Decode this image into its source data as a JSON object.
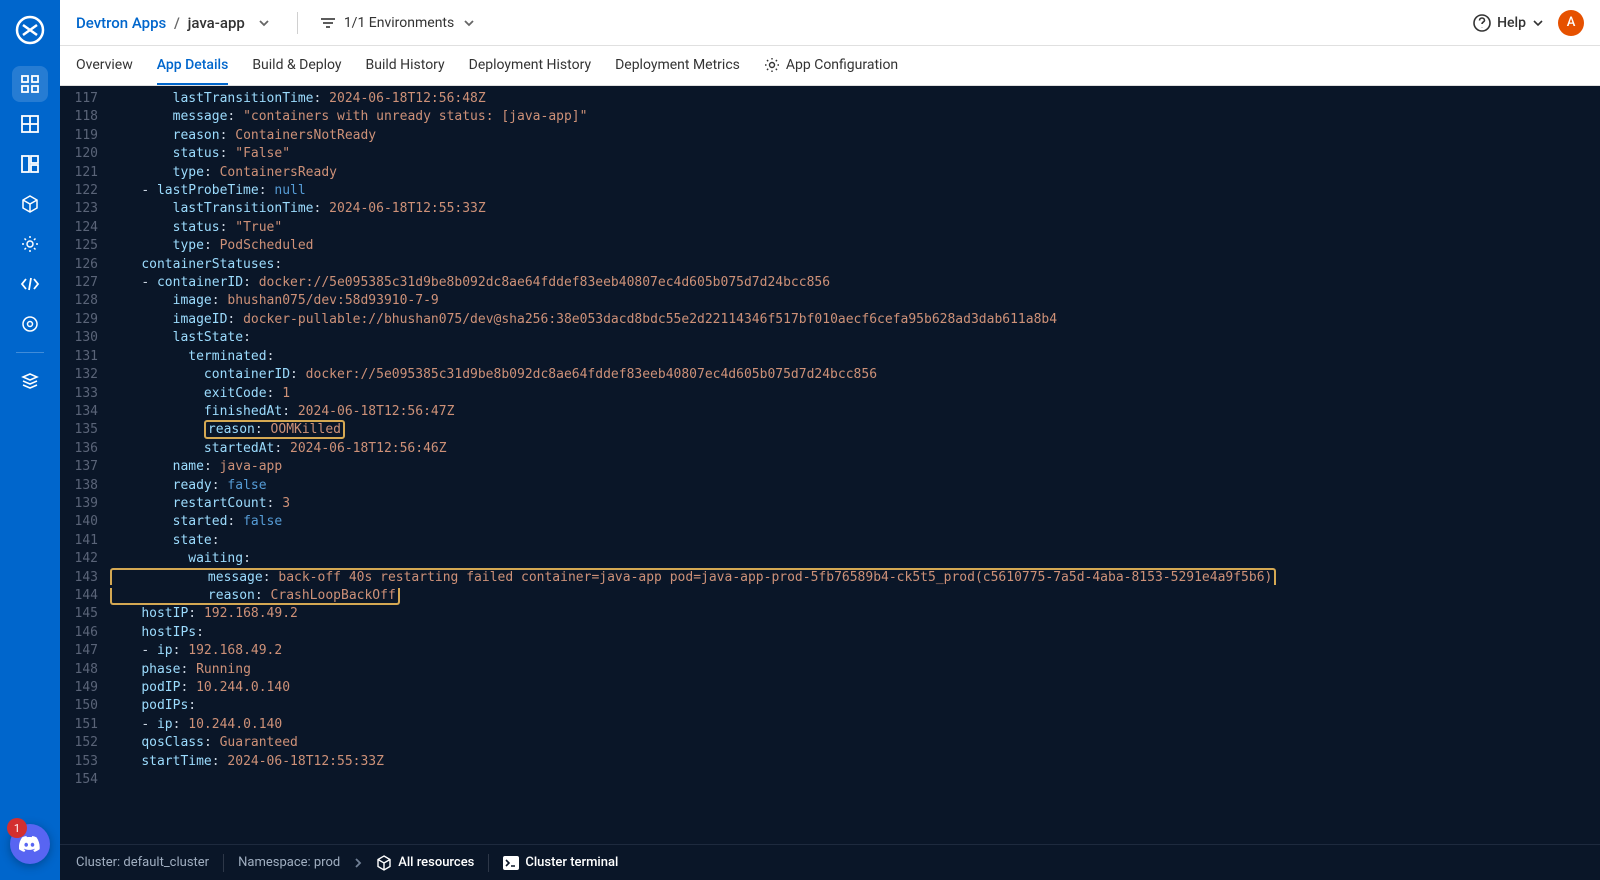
{
  "header": {
    "breadcrumb_root": "Devtron Apps",
    "breadcrumb_app": "java-app",
    "env_filter_label": "1/1 Environments",
    "help_label": "Help",
    "avatar_initial": "A"
  },
  "tabs": {
    "overview": "Overview",
    "app_details": "App Details",
    "build_deploy": "Build & Deploy",
    "build_history": "Build History",
    "deployment_history": "Deployment History",
    "deployment_metrics": "Deployment Metrics",
    "app_configuration": "App Configuration"
  },
  "discord_count": "1",
  "footer": {
    "cluster": "Cluster: default_cluster",
    "namespace": "Namespace: prod",
    "all_resources": "All resources",
    "cluster_terminal": "Cluster terminal"
  },
  "yaml_lines": [
    {
      "num": 117,
      "indent": 4,
      "key": "lastTransitionTime",
      "val": "2024-06-18T12:56:48Z"
    },
    {
      "num": 118,
      "indent": 4,
      "key": "message",
      "val": "\"containers with unready status: [java-app]\""
    },
    {
      "num": 119,
      "indent": 4,
      "key": "reason",
      "val": "ContainersNotReady"
    },
    {
      "num": 120,
      "indent": 4,
      "key": "status",
      "val": "\"False\""
    },
    {
      "num": 121,
      "indent": 4,
      "key": "type",
      "val": "ContainersReady"
    },
    {
      "num": 122,
      "indent": 3,
      "dash": true,
      "key": "lastProbeTime",
      "val": "null",
      "bool": true
    },
    {
      "num": 123,
      "indent": 4,
      "key": "lastTransitionTime",
      "val": "2024-06-18T12:55:33Z"
    },
    {
      "num": 124,
      "indent": 4,
      "key": "status",
      "val": "\"True\""
    },
    {
      "num": 125,
      "indent": 4,
      "key": "type",
      "val": "PodScheduled"
    },
    {
      "num": 126,
      "indent": 2,
      "key": "containerStatuses",
      "val": ""
    },
    {
      "num": 127,
      "indent": 3,
      "dash": true,
      "key": "containerID",
      "val": "docker://5e095385c31d9be8b092dc8ae64fddef83eeb40807ec4d605b075d7d24bcc856"
    },
    {
      "num": 128,
      "indent": 4,
      "key": "image",
      "val": "bhushan075/dev:58d93910-7-9"
    },
    {
      "num": 129,
      "indent": 4,
      "key": "imageID",
      "val": "docker-pullable://bhushan075/dev@sha256:38e053dacd8bdc55e2d22114346f517bf010aecf6cefa95b628ad3dab611a8b4"
    },
    {
      "num": 130,
      "indent": 4,
      "key": "lastState",
      "val": ""
    },
    {
      "num": 131,
      "indent": 5,
      "key": "terminated",
      "val": ""
    },
    {
      "num": 132,
      "indent": 6,
      "key": "containerID",
      "val": "docker://5e095385c31d9be8b092dc8ae64fddef83eeb40807ec4d605b075d7d24bcc856"
    },
    {
      "num": 133,
      "indent": 6,
      "key": "exitCode",
      "val": "1"
    },
    {
      "num": 134,
      "indent": 6,
      "key": "finishedAt",
      "val": "2024-06-18T12:56:47Z"
    },
    {
      "num": 135,
      "indent": 6,
      "key": "reason",
      "val": "OOMKilled",
      "highlight": "inline"
    },
    {
      "num": 136,
      "indent": 6,
      "key": "startedAt",
      "val": "2024-06-18T12:56:46Z"
    },
    {
      "num": 137,
      "indent": 4,
      "key": "name",
      "val": "java-app"
    },
    {
      "num": 138,
      "indent": 4,
      "key": "ready",
      "val": "false",
      "bool": true
    },
    {
      "num": 139,
      "indent": 4,
      "key": "restartCount",
      "val": "3"
    },
    {
      "num": 140,
      "indent": 4,
      "key": "started",
      "val": "false",
      "bool": true
    },
    {
      "num": 141,
      "indent": 4,
      "key": "state",
      "val": ""
    },
    {
      "num": 142,
      "indent": 5,
      "key": "waiting",
      "val": ""
    },
    {
      "num": 143,
      "indent": 6,
      "key": "message",
      "val": "back-off 40s restarting failed container=java-app pod=java-app-prod-5fb76589b4-ck5t5_prod(c5610775-7a5d-4aba-8153-5291e4a9f5b6)",
      "highlight": "block-start"
    },
    {
      "num": 144,
      "indent": 6,
      "key": "reason",
      "val": "CrashLoopBackOff",
      "highlight": "block-end"
    },
    {
      "num": 145,
      "indent": 2,
      "key": "hostIP",
      "val": "192.168.49.2"
    },
    {
      "num": 146,
      "indent": 2,
      "key": "hostIPs",
      "val": ""
    },
    {
      "num": 147,
      "indent": 3,
      "dash": true,
      "key": "ip",
      "val": "192.168.49.2"
    },
    {
      "num": 148,
      "indent": 2,
      "key": "phase",
      "val": "Running"
    },
    {
      "num": 149,
      "indent": 2,
      "key": "podIP",
      "val": "10.244.0.140"
    },
    {
      "num": 150,
      "indent": 2,
      "key": "podIPs",
      "val": ""
    },
    {
      "num": 151,
      "indent": 3,
      "dash": true,
      "key": "ip",
      "val": "10.244.0.140"
    },
    {
      "num": 152,
      "indent": 2,
      "key": "qosClass",
      "val": "Guaranteed"
    },
    {
      "num": 153,
      "indent": 2,
      "key": "startTime",
      "val": "2024-06-18T12:55:33Z"
    },
    {
      "num": 154,
      "indent": 0,
      "raw": ""
    }
  ]
}
